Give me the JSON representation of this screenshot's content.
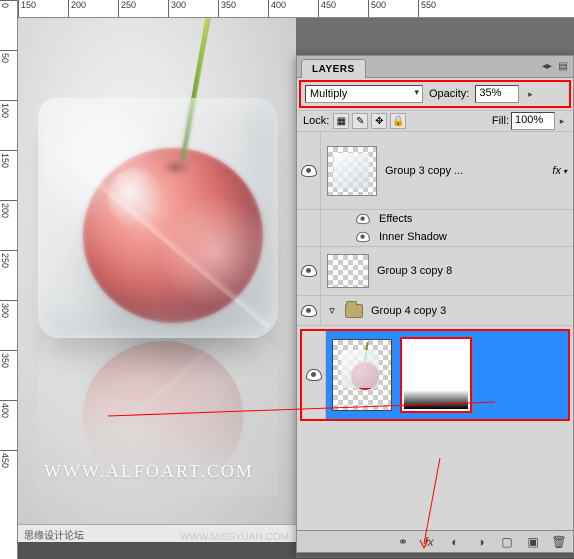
{
  "panel": {
    "title": "LAYERS",
    "blend_mode": "Multiply",
    "opacity_label": "Opacity:",
    "opacity_value": "35%",
    "lock_label": "Lock:",
    "fill_label": "Fill:",
    "fill_value": "100%"
  },
  "layers": {
    "group3copy": "Group 3 copy ...",
    "effects_label": "Effects",
    "inner_shadow": "Inner Shadow",
    "group3copy8": "Group 3 copy 8",
    "group4copy3": "Group 4 copy 3",
    "fx_badge": "fx"
  },
  "ruler": {
    "cols": [
      "150",
      "200",
      "250",
      "300",
      "350",
      "400",
      "450",
      "500",
      "550"
    ],
    "rows": [
      "0",
      "50",
      "100",
      "150",
      "200",
      "250",
      "300",
      "350",
      "400",
      "450"
    ]
  },
  "watermark": "WWW.ALFOART.COM",
  "docbar": "思缘设计论坛",
  "docbar_url": "WWW.MISSYUAN.COM"
}
